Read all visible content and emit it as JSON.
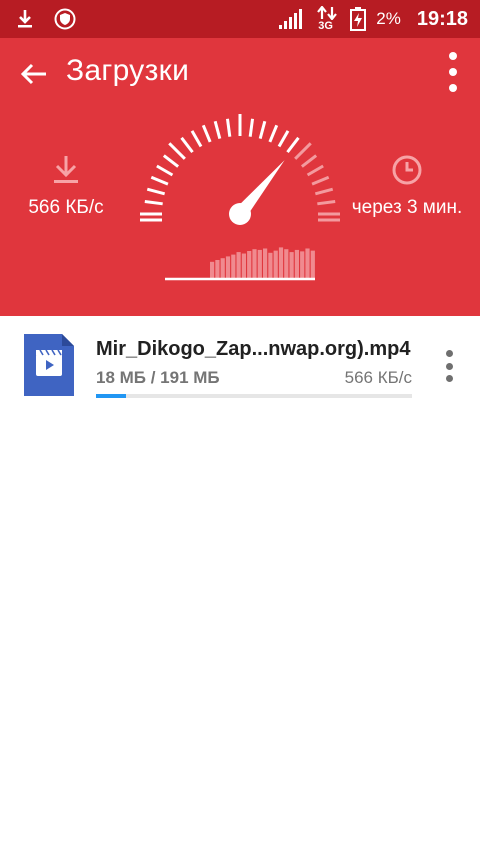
{
  "status_bar": {
    "battery_percent": "2%",
    "time": "19:18",
    "network_type": "3G",
    "icons": [
      "download-icon",
      "shield-icon",
      "signal-icon",
      "data-transfer-icon",
      "battery-charging-icon"
    ]
  },
  "toolbar": {
    "title": "Загрузки",
    "back_icon": "arrow-left-icon",
    "menu_icon": "more-vert-icon"
  },
  "stats": {
    "speed": "566 КБ/с",
    "speed_icon": "download-arrow-icon",
    "eta": "через 3 мин.",
    "eta_icon": "clock-icon"
  },
  "gauge": {
    "needle_fraction": 0.72,
    "histogram": [
      0.45,
      0.5,
      0.55,
      0.6,
      0.65,
      0.72,
      0.68,
      0.75,
      0.8,
      0.78,
      0.82,
      0.7,
      0.76,
      0.85,
      0.8,
      0.72,
      0.78,
      0.74,
      0.82,
      0.76
    ]
  },
  "downloads": [
    {
      "name": "Mir_Dikogo_Zap...nwap.org).mp4",
      "size": "18 МБ / 191 МБ",
      "speed": "566 КБ/с",
      "progress": 0.094,
      "icon": "video-file-icon"
    }
  ],
  "colors": {
    "status_bar": "#b71c23",
    "header": "#e0363d",
    "accent": "#2196f3",
    "file_icon": "#3f64c2"
  }
}
